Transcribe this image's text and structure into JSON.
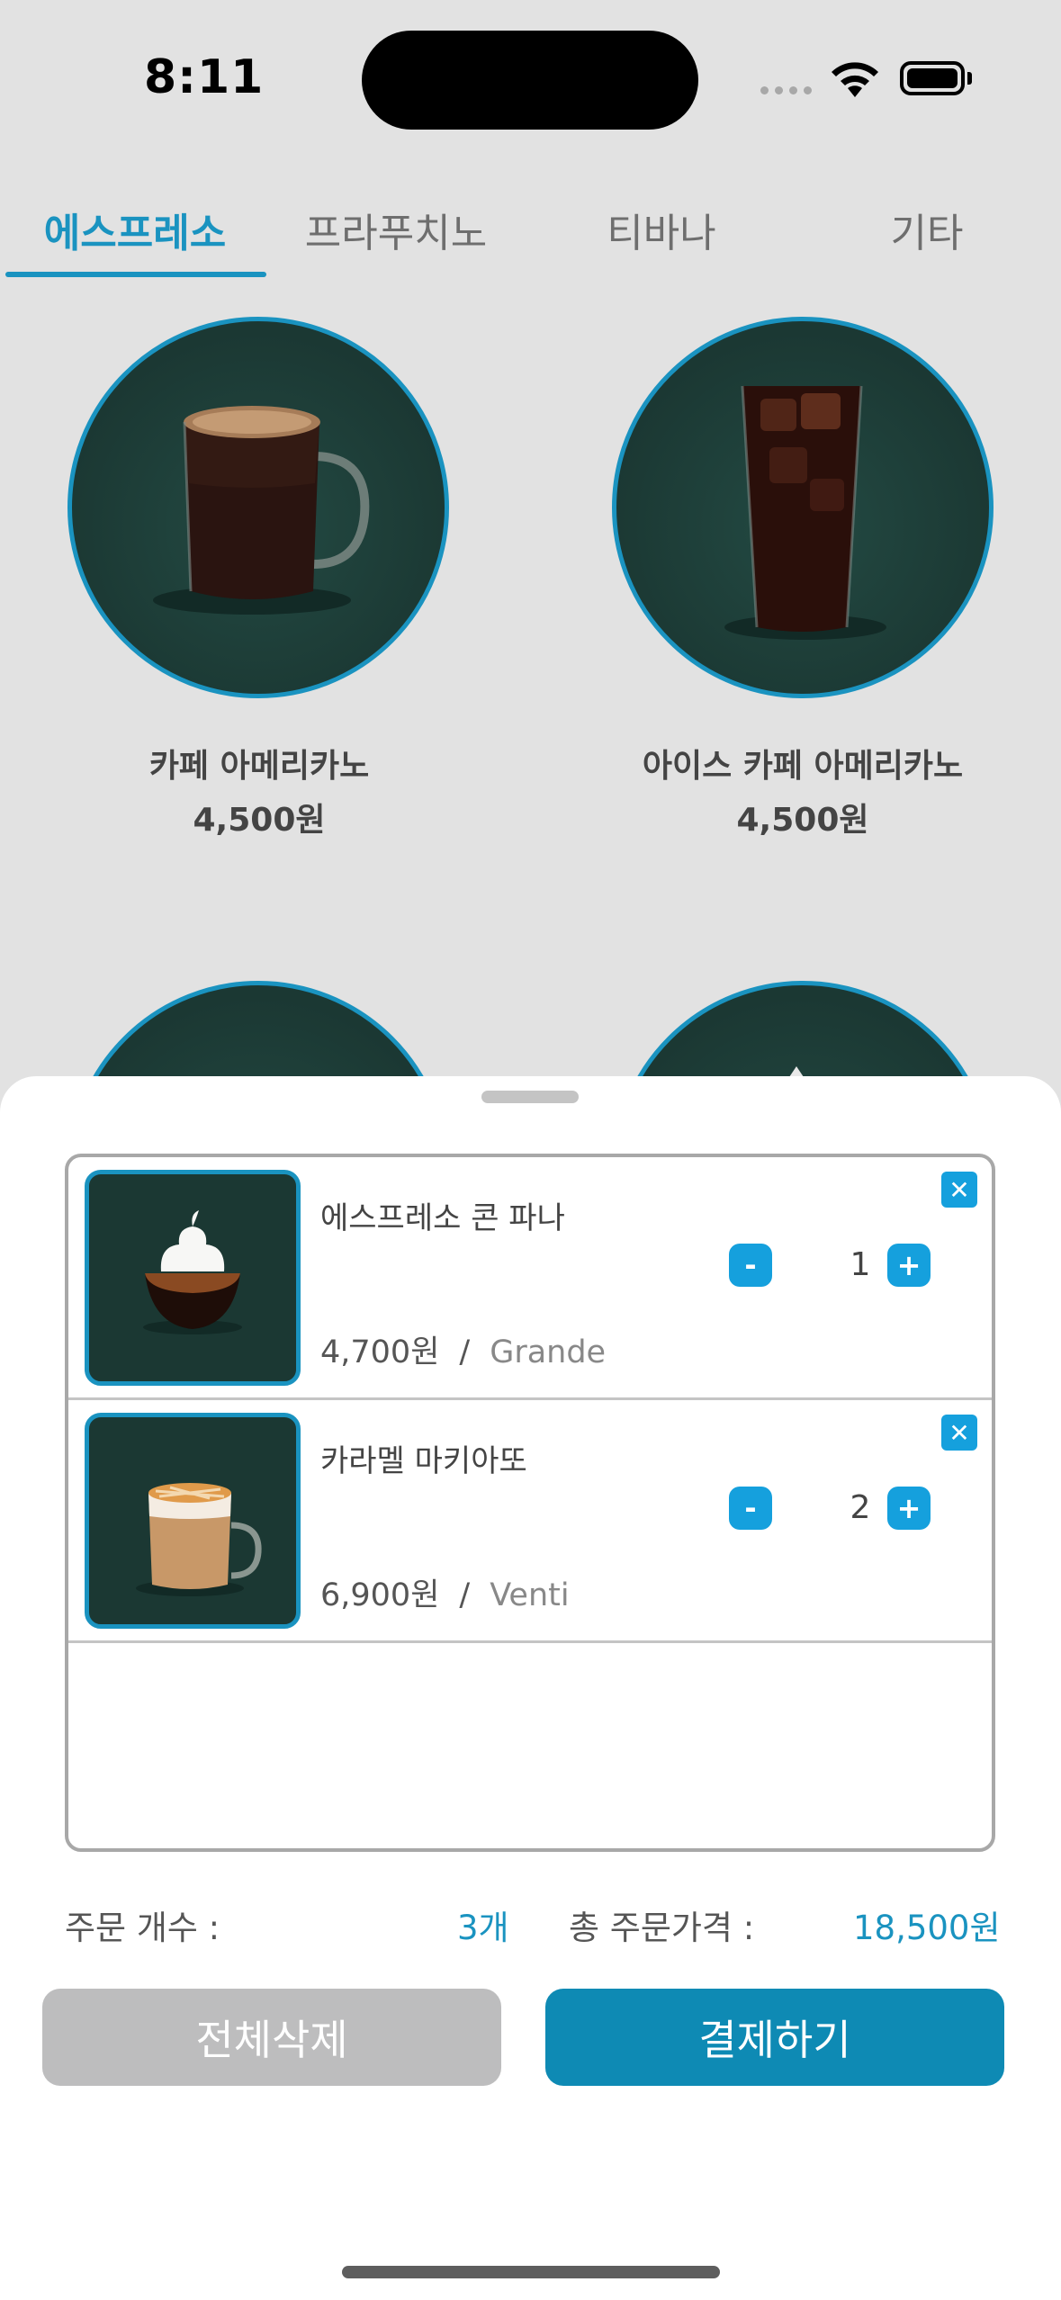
{
  "status_bar": {
    "time": "8:11"
  },
  "tabs": [
    {
      "label": "에스프레소",
      "active": true
    },
    {
      "label": "프라푸치노",
      "active": false
    },
    {
      "label": "티바나",
      "active": false
    },
    {
      "label": "기타",
      "active": false
    }
  ],
  "products": [
    {
      "name": "카페 아메리카노",
      "price": "4,500원"
    },
    {
      "name": "아이스 카페 아메리카노",
      "price": "4,500원"
    }
  ],
  "cart": {
    "items": [
      {
        "name": "에스프레소 콘 파나",
        "price": "4,700원",
        "separator": "/",
        "size": "Grande",
        "quantity": "1",
        "minus": "-",
        "plus": "+",
        "remove": "✕"
      },
      {
        "name": "카라멜 마키아또",
        "price": "6,900원",
        "separator": "/",
        "size": "Venti",
        "quantity": "2",
        "minus": "-",
        "plus": "+",
        "remove": "✕"
      }
    ]
  },
  "summary": {
    "count_label": "주문 개수 :",
    "count_value": "3개",
    "total_label": "총 주문가격 :",
    "total_value": "18,500원"
  },
  "buttons": {
    "clear_all": "전체삭제",
    "pay": "결제하기"
  },
  "colors": {
    "accent": "#1a93c0",
    "product_bg": "#1b3833",
    "pay_button": "#0e8ab4",
    "clear_button": "#bdbdbe"
  }
}
